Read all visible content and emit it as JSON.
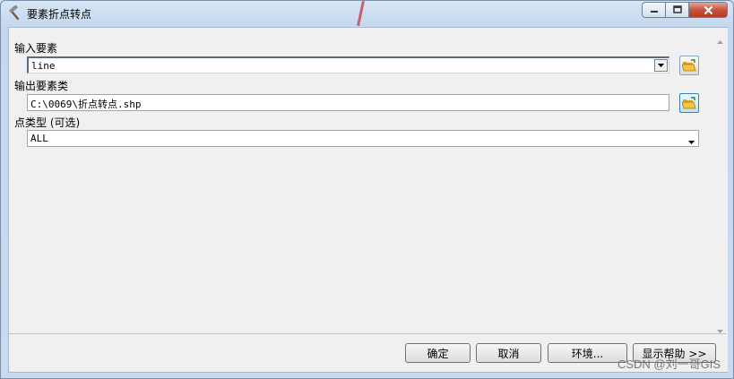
{
  "window": {
    "title": "要素折点转点",
    "title_icon": "hammer-tool-icon",
    "minimize_glyph": "▭",
    "maximize_glyph": "▣",
    "close_glyph": "✕"
  },
  "form": {
    "input_features": {
      "label": "输入要素",
      "value": "line",
      "icon": "folder-open-icon"
    },
    "output_feature_class": {
      "label": "输出要素类",
      "value": "C:\\0069\\折点转点.shp",
      "icon": "folder-open-icon"
    },
    "point_type": {
      "label": "点类型 (可选)",
      "value": "ALL"
    }
  },
  "buttons": {
    "ok": "确定",
    "cancel": "取消",
    "environments": "环境...",
    "show_help": "显示帮助 >>"
  },
  "watermark": "CSDN @刘一哥GIS",
  "colors": {
    "title_bg": "#c9dbef",
    "client_bg": "#f0f0f0",
    "close_button": "#c8523b"
  }
}
